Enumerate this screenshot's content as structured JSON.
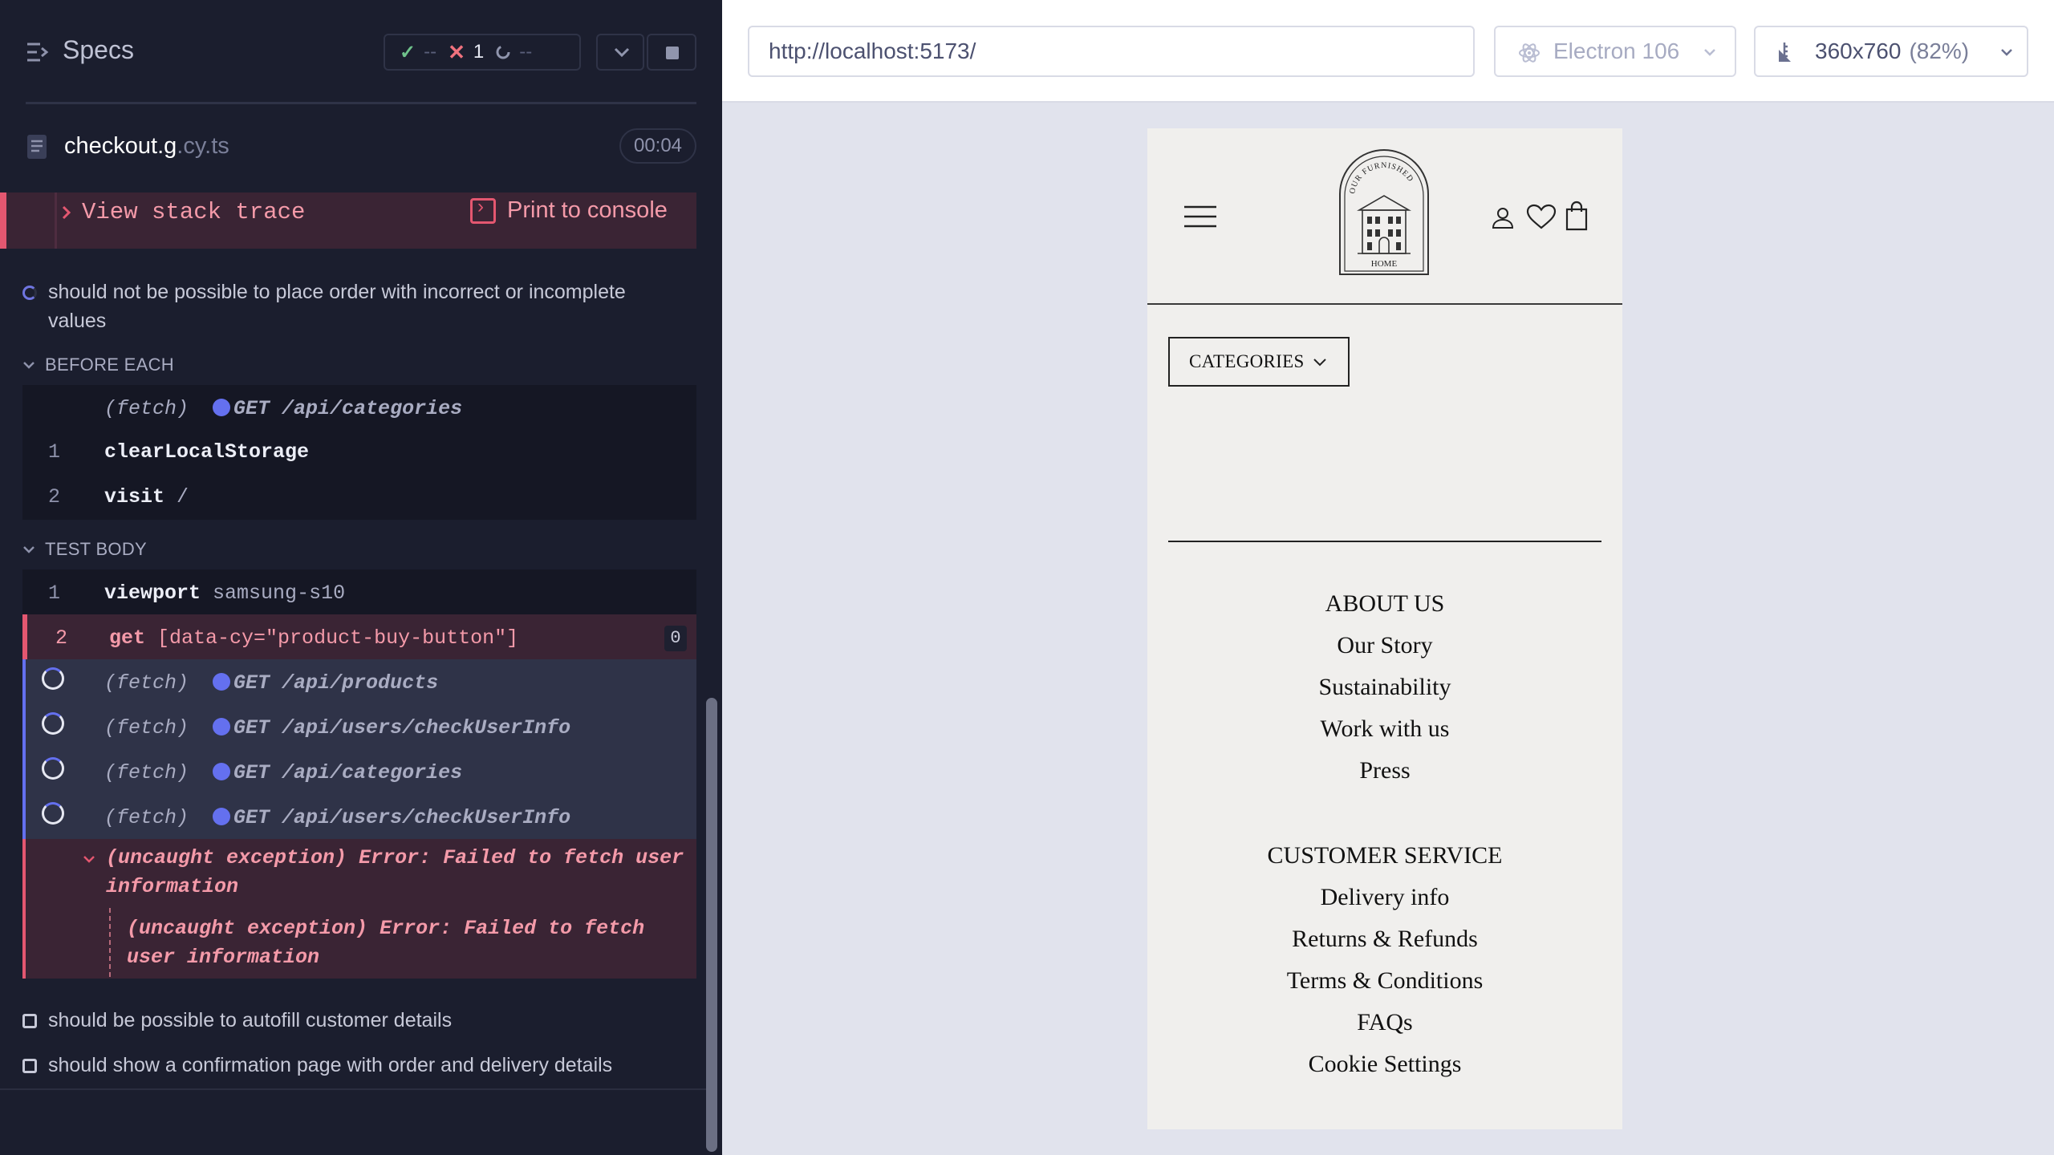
{
  "reporter": {
    "title": "Specs",
    "stats": {
      "passed": "--",
      "failed": "1",
      "pending": "--"
    },
    "file": {
      "name": "checkout.g",
      "ext": ".cy.ts",
      "duration": "00:04"
    },
    "error_actions": {
      "stack_trace": "View stack trace",
      "print": "Print to console"
    },
    "current_test": "should not be possible to place order with incorrect or incomplete values",
    "before_each": {
      "label": "BEFORE EACH",
      "commands": [
        {
          "num": "",
          "type": "fetch",
          "method": "(fetch)",
          "url": "GET /api/categories"
        },
        {
          "num": "1",
          "name": "clearLocalStorage",
          "msg": ""
        },
        {
          "num": "2",
          "name": "visit",
          "msg": "/"
        }
      ]
    },
    "test_body": {
      "label": "TEST BODY",
      "commands": [
        {
          "num": "1",
          "name": "viewport",
          "msg": "samsung-s10"
        },
        {
          "num": "2",
          "name": "get",
          "msg": "[data-cy=\"product-buy-button\"]",
          "count": "0"
        },
        {
          "method": "(fetch)",
          "url": "GET /api/products"
        },
        {
          "method": "(fetch)",
          "url": "GET /api/users/checkUserInfo"
        },
        {
          "method": "(fetch)",
          "url": "GET /api/categories"
        },
        {
          "method": "(fetch)",
          "url": "GET /api/users/checkUserInfo"
        }
      ],
      "exception": {
        "label": "(uncaught exception)",
        "line1": "Error: Failed to fetch user",
        "line2": "information",
        "inner_label": "(uncaught exception)",
        "inner_line1": "Error: Failed to fetch",
        "inner_line2": "user information"
      }
    },
    "pending_tests": [
      "should be possible to autofill customer details",
      "should show a confirmation page with order and delivery details"
    ]
  },
  "aut": {
    "url": "http://localhost:5173/",
    "browser": "Electron 106",
    "viewport": "360x760",
    "viewport_pct": "(82%)",
    "app": {
      "categories_label": "CATEGORIES",
      "logo_text_top": "OUR FURNISHED",
      "logo_text_bottom": "HOME",
      "about_heading": "ABOUT US",
      "about_links": [
        "Our Story",
        "Sustainability",
        "Work with us",
        "Press"
      ],
      "service_heading": "CUSTOMER SERVICE",
      "service_links": [
        "Delivery info",
        "Returns & Refunds",
        "Terms & Conditions",
        "FAQs",
        "Cookie Settings"
      ]
    }
  },
  "colors": {
    "reporter_bg": "#1b1e2e",
    "failed": "#e45770",
    "pending": "#6470ef",
    "passed": "#6fc28b"
  }
}
